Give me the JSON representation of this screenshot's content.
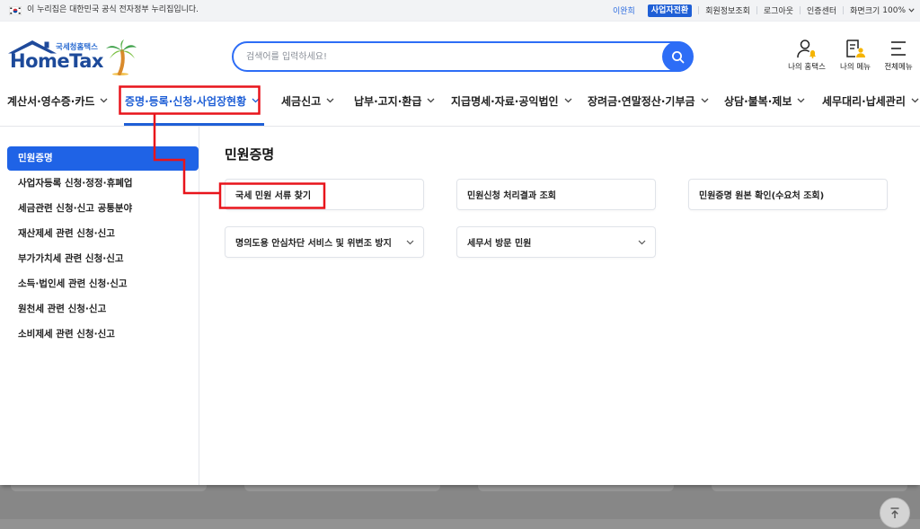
{
  "top_bar": {
    "notice": "이 누리집은 대한민국 공식 전자정부 누리집입니다.",
    "user_name": "이완희",
    "switch_button": "사업자전환",
    "member_info": "회원정보조회",
    "logout": "로그아웃",
    "cert_center": "인증센터",
    "zoom_label": "화면크기",
    "zoom_value": "100%",
    "flag_icon": "korea-flag-icon"
  },
  "header": {
    "logo_subtitle": "국세청홈택스",
    "logo_title": "HomeTax",
    "search_placeholder": "검색어를 입력하세요!",
    "search_icon": "search-icon",
    "quick_menu": [
      {
        "label": "나의 홈택스",
        "icon": "user-bell-icon"
      },
      {
        "label": "나의 메뉴",
        "icon": "document-user-icon"
      },
      {
        "label": "전체메뉴",
        "icon": "hamburger-menu-icon"
      }
    ]
  },
  "nav": {
    "items": [
      {
        "label": "계산서·영수증·카드",
        "active": false
      },
      {
        "label": "증명·등록·신청·사업장현황",
        "active": true
      },
      {
        "label": "세금신고",
        "active": false
      },
      {
        "label": "납부·고지·환급",
        "active": false
      },
      {
        "label": "지급명세·자료·공익법인",
        "active": false
      },
      {
        "label": "장려금·연말정산·기부금",
        "active": false
      },
      {
        "label": "상담·불복·제보",
        "active": false
      },
      {
        "label": "세무대리·납세관리",
        "active": false
      }
    ]
  },
  "sidebar": {
    "items": [
      {
        "label": "민원증명",
        "active": true
      },
      {
        "label": "사업자등록 신청·정정·휴폐업",
        "active": false
      },
      {
        "label": "세금관련 신청·신고 공통분야",
        "active": false
      },
      {
        "label": "재산제세 관련 신청·신고",
        "active": false
      },
      {
        "label": "부가가치세 관련 신청·신고",
        "active": false
      },
      {
        "label": "소득·법인세 관련 신청·신고",
        "active": false
      },
      {
        "label": "원천세 관련 신청·신고",
        "active": false
      },
      {
        "label": "소비제세 관련 신청·신고",
        "active": false
      }
    ]
  },
  "main": {
    "title": "민원증명",
    "cards": [
      {
        "label": "국세 민원 서류 찾기",
        "expandable": false
      },
      {
        "label": "민원신청 처리결과 조회",
        "expandable": false
      },
      {
        "label": "민원증명 원본 확인(수요처 조회)",
        "expandable": false
      },
      {
        "label": "명의도용 안심차단 서비스 및 위변조 방지",
        "expandable": true
      },
      {
        "label": "세무서 방문 민원",
        "expandable": true
      }
    ]
  },
  "colors": {
    "brand_blue": "#1f5fd6",
    "search_blue": "#2d6df6",
    "annotation_red": "#e8141b",
    "accent_yellow": "#f5b400"
  }
}
